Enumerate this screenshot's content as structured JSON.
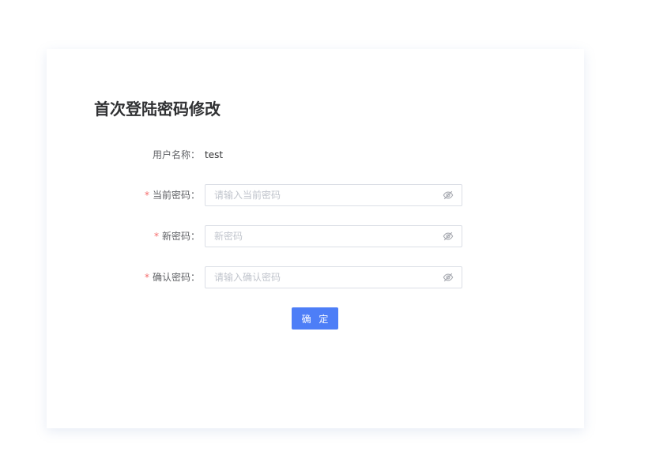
{
  "form": {
    "title": "首次登陆密码修改",
    "username": {
      "label": "用户名称：",
      "value": "test"
    },
    "current_password": {
      "label": "当前密码：",
      "required": "*",
      "placeholder": "请输入当前密码"
    },
    "new_password": {
      "label": "新密码：",
      "required": "*",
      "placeholder": "新密码"
    },
    "confirm_password": {
      "label": "确认密码：",
      "required": "*",
      "placeholder": "请输入确认密码"
    },
    "submit_label": "确 定"
  },
  "colors": {
    "primary": "#4d7ef7",
    "required": "#f56c6c",
    "border": "#dcdfe6",
    "placeholder": "#c0c4cc"
  }
}
